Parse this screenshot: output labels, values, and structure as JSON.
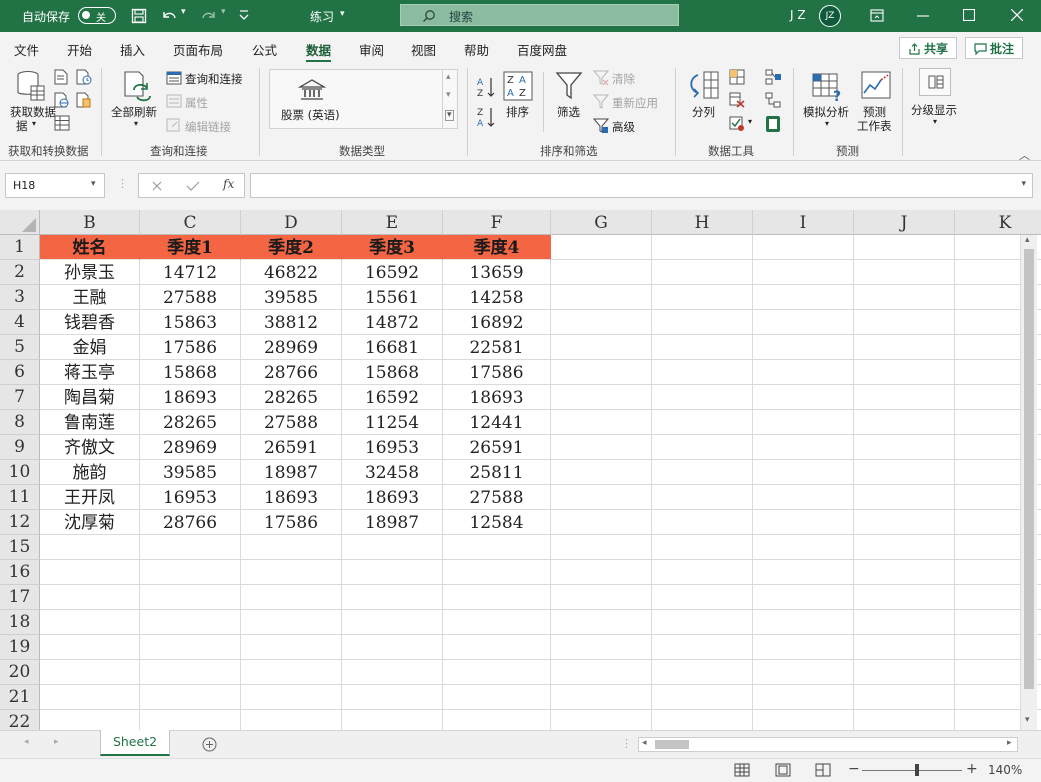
{
  "titlebar": {
    "autosave_label": "自动保存",
    "autosave_state": "关",
    "doc_title": "练习",
    "search_placeholder": "搜索",
    "user_initials": "J Z",
    "avatar_initials": "JZ"
  },
  "tabs": {
    "items": [
      "文件",
      "开始",
      "插入",
      "页面布局",
      "公式",
      "数据",
      "审阅",
      "视图",
      "帮助",
      "百度网盘"
    ],
    "active": "数据",
    "share": "共享",
    "comments": "批注"
  },
  "ribbon": {
    "get_data": "获取数据",
    "get_data_2": "据",
    "refresh_all": "全部刷新",
    "queries_connections": "查询和连接",
    "properties": "属性",
    "edit_links": "编辑链接",
    "stocks": "股票 (英语)",
    "sort": "排序",
    "filter": "筛选",
    "clear": "清除",
    "reapply": "重新应用",
    "advanced": "高级",
    "text_to_columns": "分列",
    "what_if": "模拟分析",
    "forecast_sheet_1": "预测",
    "forecast_sheet_2": "工作表",
    "outline": "分级显示",
    "groups": {
      "get_transform": "获取和转换数据",
      "queries": "查询和连接",
      "data_types": "数据类型",
      "sort_filter": "排序和筛选",
      "data_tools": "数据工具",
      "forecast": "预测"
    }
  },
  "formula_bar": {
    "name_box": "H18",
    "fx": "fx",
    "value": ""
  },
  "columns": [
    "B",
    "C",
    "D",
    "E",
    "F",
    "G",
    "H",
    "I",
    "J",
    "K"
  ],
  "row_numbers": [
    "1",
    "2",
    "3",
    "4",
    "5",
    "6",
    "7",
    "8",
    "9",
    "10",
    "11",
    "12",
    "15",
    "16",
    "17",
    "18",
    "19",
    "20",
    "21",
    "22"
  ],
  "table": {
    "headers": [
      "姓名",
      "季度1",
      "季度2",
      "季度3",
      "季度4"
    ],
    "rows": [
      [
        "孙景玉",
        "14712",
        "46822",
        "16592",
        "13659"
      ],
      [
        "王融",
        "27588",
        "39585",
        "15561",
        "14258"
      ],
      [
        "钱碧香",
        "15863",
        "38812",
        "14872",
        "16892"
      ],
      [
        "金娟",
        "17586",
        "28969",
        "16681",
        "22581"
      ],
      [
        "蒋玉亭",
        "15868",
        "28766",
        "15868",
        "17586"
      ],
      [
        "陶昌菊",
        "18693",
        "28265",
        "16592",
        "18693"
      ],
      [
        "鲁南莲",
        "28265",
        "27588",
        "11254",
        "12441"
      ],
      [
        "齐傲文",
        "28969",
        "26591",
        "16953",
        "26591"
      ],
      [
        "施韵",
        "39585",
        "18987",
        "32458",
        "25811"
      ],
      [
        "王开凤",
        "16953",
        "18693",
        "18693",
        "27588"
      ],
      [
        "沈厚菊",
        "28766",
        "17586",
        "18987",
        "12584"
      ]
    ]
  },
  "sheets": [
    "Sheet2"
  ],
  "status": {
    "zoom": "140%"
  },
  "colors": {
    "accent": "#217346",
    "header_fill": "#f46543"
  }
}
